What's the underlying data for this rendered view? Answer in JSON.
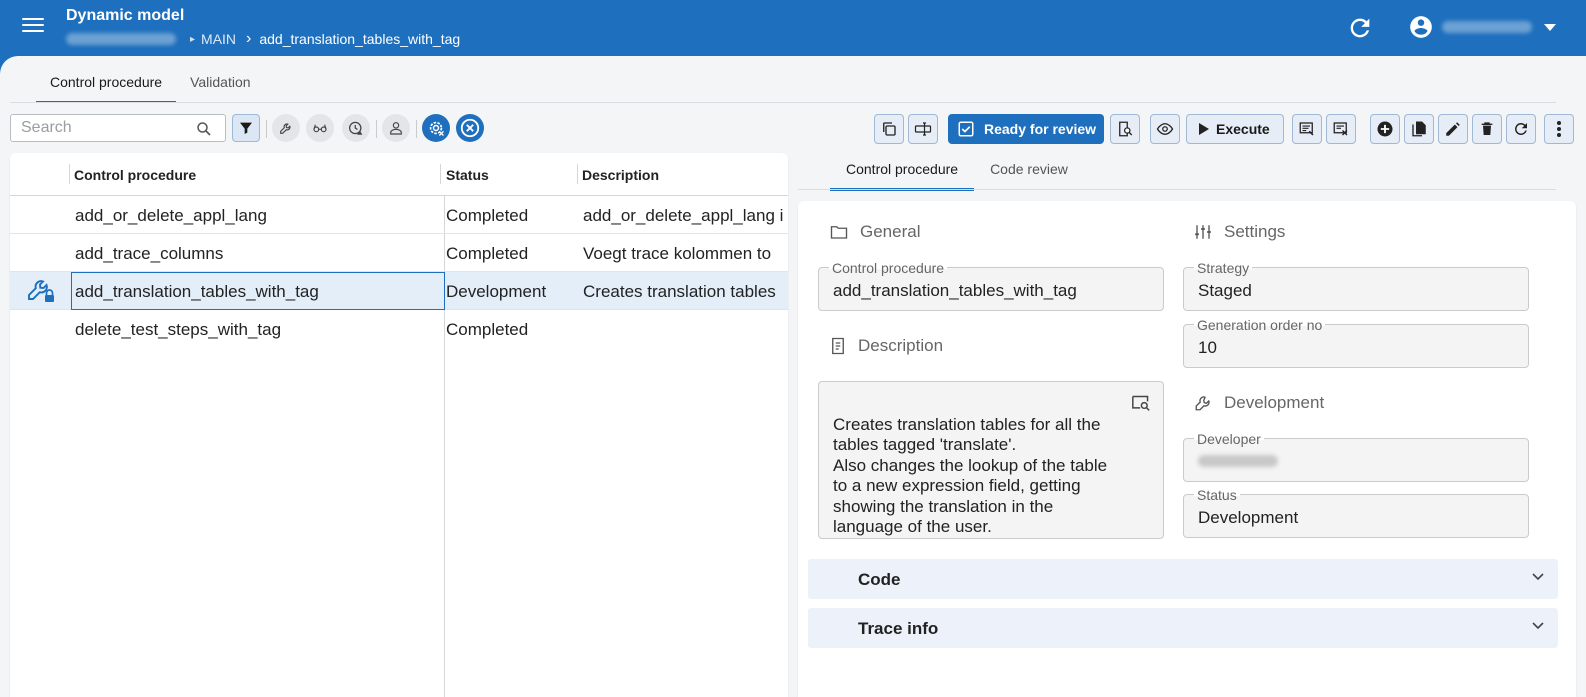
{
  "header": {
    "title": "Dynamic model",
    "breadcrumb": {
      "main": "MAIN",
      "current": "add_translation_tables_with_tag"
    }
  },
  "top_tabs": [
    "Control procedure",
    "Validation"
  ],
  "toolbar": {
    "search_placeholder": "Search",
    "ready_label": "Ready for review",
    "execute_label": "Execute"
  },
  "grid": {
    "columns": [
      "Control procedure",
      "Status",
      "Description"
    ],
    "rows": [
      {
        "name": "add_or_delete_appl_lang",
        "status": "Completed",
        "description": "add_or_delete_appl_lang i"
      },
      {
        "name": "add_trace_columns",
        "status": "Completed",
        "description": "Voegt trace kolommen to"
      },
      {
        "name": "add_translation_tables_with_tag",
        "status": "Development",
        "description": "Creates translation tables"
      },
      {
        "name": "delete_test_steps_with_tag",
        "status": "Completed",
        "description": ""
      }
    ]
  },
  "detail": {
    "tabs": [
      "Control procedure",
      "Code review"
    ],
    "general": {
      "title": "General",
      "control_procedure_label": "Control procedure",
      "control_procedure_value": "add_translation_tables_with_tag"
    },
    "description": {
      "title": "Description",
      "text": "Creates translation tables for all the\ntables tagged 'translate'.\nAlso changes the lookup of the table\nto a new expression field, getting\nshowing the translation in the\nlanguage of the user."
    },
    "settings": {
      "title": "Settings",
      "strategy_label": "Strategy",
      "strategy_value": "Staged",
      "generation_label": "Generation order no",
      "generation_value": "10"
    },
    "development": {
      "title": "Development",
      "developer_label": "Developer",
      "status_label": "Status",
      "status_value": "Development"
    },
    "accordions": [
      "Code",
      "Trace info"
    ]
  },
  "colors": {
    "primary": "#1e6fbd",
    "selected_row": "#e3eef9",
    "accordion_bg": "#edf2fa"
  }
}
